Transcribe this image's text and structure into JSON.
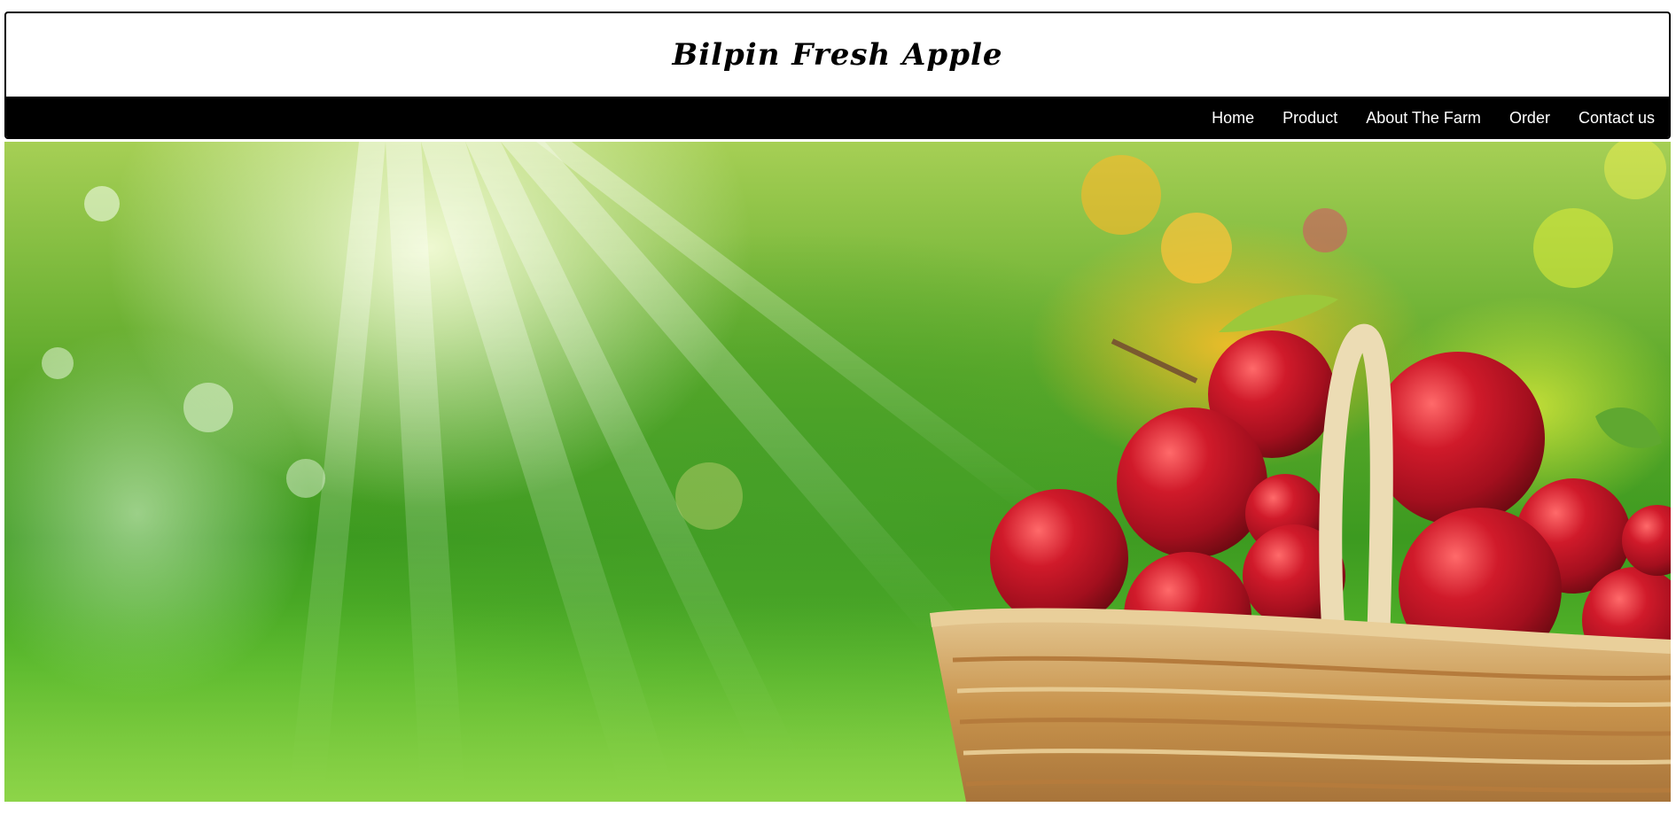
{
  "header": {
    "brand_title": "Bilpin Fresh Apple"
  },
  "nav": {
    "items": [
      {
        "label": "Home"
      },
      {
        "label": "Product"
      },
      {
        "label": "About The Farm"
      },
      {
        "label": "Order"
      },
      {
        "label": "Contact us"
      }
    ]
  },
  "hero": {
    "image_subject": "apple-basket-photo",
    "colors": {
      "grass": "#4fae2a",
      "apple": "#c8102e",
      "basket": "#c99a55",
      "sunlight": "#f8ffe0"
    }
  }
}
